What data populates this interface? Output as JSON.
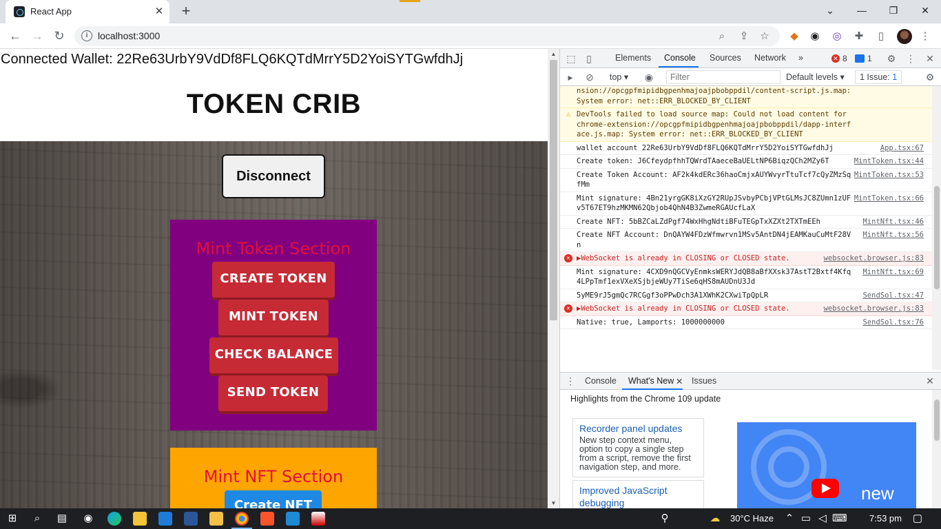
{
  "browser": {
    "tab_title": "React App",
    "tab_close": "✕",
    "new_tab": "+",
    "window_controls": {
      "dropdown": "⌄",
      "minimize": "—",
      "restore": "❐",
      "close": "✕"
    },
    "url": "localhost:3000",
    "nav": {
      "back": "←",
      "forward": "→",
      "reload": "↻"
    }
  },
  "app": {
    "connected_wallet": "Connected Wallet: 22Re63UrbY9VdDf8FLQ6KQTdMrrY5D2YoiSYTGwfdhJj",
    "title": "TOKEN CRIB",
    "disconnect_label": "Disconnect",
    "mint_section": {
      "title": "Mint Token Section",
      "buttons": [
        "CREATE TOKEN",
        "MINT TOKEN",
        "CHECK BALANCE",
        "SEND TOKEN"
      ]
    },
    "nft_section": {
      "title": "Mint NFT Section",
      "button": "Create NFT"
    }
  },
  "devtools": {
    "tabs": [
      "Elements",
      "Console",
      "Sources",
      "Network"
    ],
    "more_tabs": "»",
    "error_count": "8",
    "message_count": "1",
    "context": "top",
    "filter_placeholder": "Filter",
    "levels": "Default levels ▾",
    "issues": "1 Issue:",
    "issues_count": "1",
    "console_rows": [
      {
        "type": "warn-cont",
        "text": "nsion://opcgpfmipidbgpenhmajoajpbobppdil/content-script.js.map: System error: net::ERR_BLOCKED_BY_CLIENT",
        "src": ""
      },
      {
        "type": "warn",
        "text": "DevTools failed to load source map: Could not load content for chrome-extension://opcgpfmipidbgpenhmajoajpbobppdil/dapp-interface.js.map: System error: net::ERR_BLOCKED_BY_CLIENT",
        "src": ""
      },
      {
        "type": "log",
        "text": "wallet account  22Re63UrbY9VdDf8FLQ6KQTdMrrY5D2YoiSYTGwfdhJj",
        "src": "App.tsx:67"
      },
      {
        "type": "log",
        "text": "Create token: J6CfeydpfhhTQWrdTAaeceBaUELtNP6BiqzQCh2MZy6T",
        "src": "MintToken.tsx:44"
      },
      {
        "type": "log",
        "text": "Create Token Account: AF2k4kdERc36haoCmjxAUYWvyrTtuTcf7cQyZMzSqfMm",
        "src": "MintToken.tsx:53"
      },
      {
        "type": "log",
        "text": "Mint signature: 4Bn21yrgGK8iXzGY2RUpJSvbyPCbjVPtGLMsJC8ZUmn1zUFv5T67ET9hzMKMN62Qbjob4QhN4B3ZwmeRGAUcfLaX",
        "src": "MintToken.tsx:66"
      },
      {
        "type": "log",
        "text": "Create NFT: 5bBZCaLZdPgf74WxHhgNdtiBFuTEGpTxXZXt2TXTmEEh",
        "src": "MintNft.tsx:46"
      },
      {
        "type": "log",
        "text": "Create NFT Account: DnQAYW4FDzWfmwrvn1MSv5AntDN4jEAMKauCuMtF28Vn",
        "src": "MintNft.tsx:56"
      },
      {
        "type": "err",
        "text": "▶WebSocket is already in CLOSING or CLOSED state.",
        "src": "websocket.browser.js:83"
      },
      {
        "type": "log",
        "text": "Mint signature: 4CXD9nQGCVyEnmksWERYJdQB8aBfXXsk37AstT2Bxtf4Kfq4LPpTmf1exVXeXSjbjeWUy7TiSe6qHS8mAUDnU3Jd",
        "src": "MintNft.tsx:69"
      },
      {
        "type": "log",
        "text": "5yME9rJ5gmQc7RCGgf3oPPwDch3A1XWhK2CXwiTpQpLR",
        "src": "SendSol.tsx:47"
      },
      {
        "type": "err",
        "text": "▶WebSocket is already in CLOSING or CLOSED state.",
        "src": "websocket.browser.js:83"
      },
      {
        "type": "log",
        "text": "Native: true, Lamports: 1000000000",
        "src": "SendSol.tsx:76"
      }
    ],
    "drawer": {
      "tabs": [
        "Console",
        "What's New",
        "Issues"
      ],
      "highlights": "Highlights from the Chrome 109 update",
      "cards": [
        {
          "title": "Recorder panel updates",
          "body": "New step context menu, option to copy a single step from a script, remove the first navigation step, and more."
        },
        {
          "title": "Improved JavaScript debugging",
          "body": ""
        }
      ],
      "video_label": "new"
    }
  },
  "taskbar": {
    "weather": "30°C  Haze",
    "time": "7:53 pm"
  },
  "colors": {
    "mint_section_bg": "#800080",
    "nft_section_bg": "#ffa500",
    "mint_button": "#c62a35",
    "section_title": "#e0103a",
    "nft_button": "#1e88e5"
  }
}
